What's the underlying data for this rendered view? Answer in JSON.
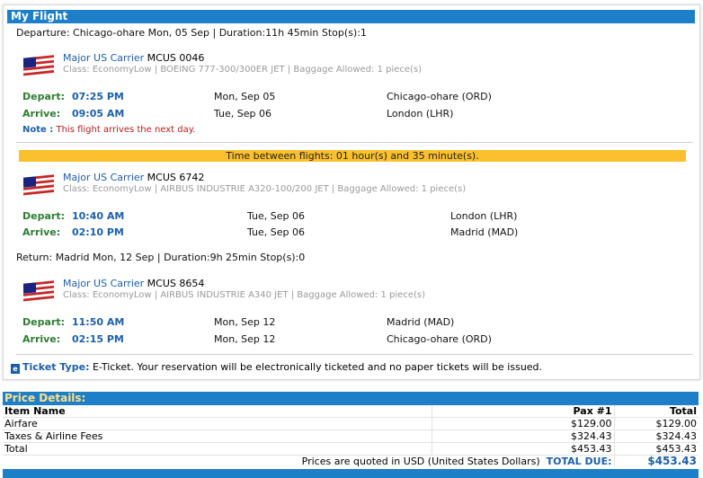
{
  "flight_box": {
    "title": "My Flight",
    "departure_line": "Departure: Chicago-ohare Mon, 05 Sep |  Duration:11h 45min  Stop(s):1",
    "return_line": "Return: Madrid Mon, 12 Sep |  Duration:9h 25min  Stop(s):0",
    "layover": "Time between flights: 01 hour(s) and 35 minute(s).",
    "note_label": "Note :",
    "note_text": " This flight arrives the next day.",
    "depart_label": "Depart:",
    "arrive_label": "Arrive:",
    "segments": [
      {
        "carrier": "Major US Carrier",
        "flight": " MCUS 0046",
        "class_line": "Class: EconomyLow | BOEING 777-300/300ER JET | Baggage Allowed: 1 piece(s)",
        "depart_time": "07:25 PM",
        "depart_date": "Mon, Sep 05",
        "depart_airport": "Chicago-ohare (ORD)",
        "arrive_time": "09:05 AM",
        "arrive_date": "Tue, Sep 06",
        "arrive_airport": "London (LHR)"
      },
      {
        "carrier": "Major US Carrier",
        "flight": " MCUS 6742",
        "class_line": "Class: EconomyLow | AIRBUS INDUSTRIE A320-100/200 JET | Baggage Allowed: 1 piece(s)",
        "depart_time": "10:40 AM",
        "depart_date": "Tue, Sep 06",
        "depart_airport": "London (LHR)",
        "arrive_time": "02:10 PM",
        "arrive_date": "Tue, Sep 06",
        "arrive_airport": "Madrid (MAD)"
      },
      {
        "carrier": "Major US Carrier",
        "flight": " MCUS 8654",
        "class_line": "Class: EconomyLow | AIRBUS INDUSTRIE A340 JET | Baggage Allowed: 1 piece(s)",
        "depart_time": "11:50 AM",
        "depart_date": "Mon, Sep 12",
        "depart_airport": "Madrid (MAD)",
        "arrive_time": "02:15 PM",
        "arrive_date": "Mon, Sep 12",
        "arrive_airport": "Chicago-ohare (ORD)"
      }
    ],
    "ticket_label": "Ticket Type:",
    "ticket_text": " E-Ticket. Your reservation will be electronically ticketed and no paper tickets will be issued."
  },
  "price": {
    "title": "Price Details:",
    "headers": [
      "Item Name",
      "Pax #1",
      "Total"
    ],
    "rows": [
      {
        "item": "Airfare",
        "pax": "$129.00",
        "total": "$129.00"
      },
      {
        "item": "Taxes & Airline Fees",
        "pax": "$324.43",
        "total": "$324.43"
      },
      {
        "item": "Total",
        "pax": "$453.43",
        "total": "$453.43"
      }
    ],
    "quote_note": "Prices are quoted in USD (United States Dollars)",
    "total_due_label": "TOTAL DUE:",
    "total_due_value": "$453.43"
  },
  "colors": {
    "header_blue": "#1e7fc9",
    "layover_yellow": "#fbc02d",
    "label_green": "#2e7d32",
    "link_blue": "#1c5fa8"
  }
}
